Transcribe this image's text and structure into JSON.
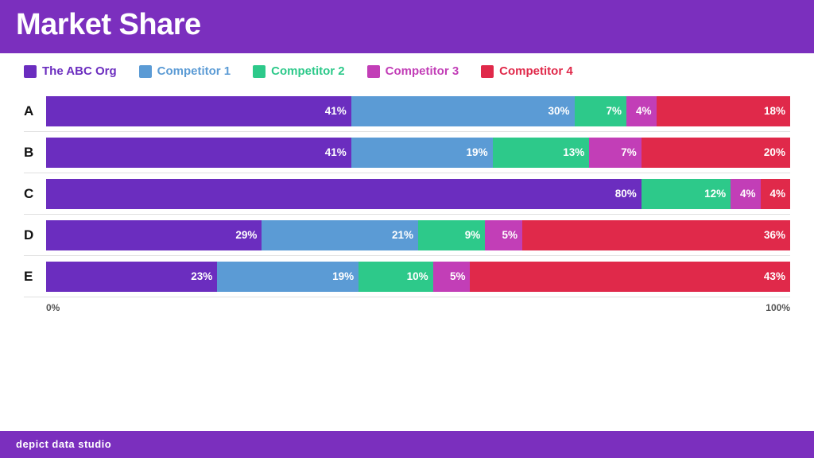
{
  "header": {
    "title": "Market Share"
  },
  "footer": {
    "label": "depict data studio"
  },
  "legend": {
    "items": [
      {
        "id": "abc",
        "label": "The ABC Org",
        "color": "#6B2DBF"
      },
      {
        "id": "c1",
        "label": "Competitor 1",
        "color": "#5B9BD5"
      },
      {
        "id": "c2",
        "label": "Competitor 2",
        "color": "#2DC98A"
      },
      {
        "id": "c3",
        "label": "Competitor 3",
        "color": "#C23EB7"
      },
      {
        "id": "c4",
        "label": "Competitor 4",
        "color": "#E0294A"
      }
    ]
  },
  "rows": [
    {
      "label": "A",
      "segments": [
        {
          "pct": 41,
          "color": "#6B2DBF",
          "text": "41%"
        },
        {
          "pct": 30,
          "color": "#5B9BD5",
          "text": "30%"
        },
        {
          "pct": 7,
          "color": "#2DC98A",
          "text": "7%"
        },
        {
          "pct": 4,
          "color": "#C23EB7",
          "text": "4%"
        },
        {
          "pct": 18,
          "color": "#E0294A",
          "text": "18%"
        }
      ]
    },
    {
      "label": "B",
      "segments": [
        {
          "pct": 41,
          "color": "#6B2DBF",
          "text": "41%"
        },
        {
          "pct": 19,
          "color": "#5B9BD5",
          "text": "19%"
        },
        {
          "pct": 13,
          "color": "#2DC98A",
          "text": "13%"
        },
        {
          "pct": 7,
          "color": "#C23EB7",
          "text": "7%"
        },
        {
          "pct": 20,
          "color": "#E0294A",
          "text": "20%"
        }
      ]
    },
    {
      "label": "C",
      "segments": [
        {
          "pct": 80,
          "color": "#6B2DBF",
          "text": "80%"
        },
        {
          "pct": 0,
          "color": "#5B9BD5",
          "text": ""
        },
        {
          "pct": 12,
          "color": "#2DC98A",
          "text": "12%"
        },
        {
          "pct": 4,
          "color": "#C23EB7",
          "text": "4%"
        },
        {
          "pct": 4,
          "color": "#E0294A",
          "text": "4%"
        }
      ]
    },
    {
      "label": "D",
      "segments": [
        {
          "pct": 29,
          "color": "#6B2DBF",
          "text": "29%"
        },
        {
          "pct": 21,
          "color": "#5B9BD5",
          "text": "21%"
        },
        {
          "pct": 9,
          "color": "#2DC98A",
          "text": "9%"
        },
        {
          "pct": 5,
          "color": "#C23EB7",
          "text": "5%"
        },
        {
          "pct": 36,
          "color": "#E0294A",
          "text": "36%"
        }
      ]
    },
    {
      "label": "E",
      "segments": [
        {
          "pct": 23,
          "color": "#6B2DBF",
          "text": "23%"
        },
        {
          "pct": 19,
          "color": "#5B9BD5",
          "text": "19%"
        },
        {
          "pct": 10,
          "color": "#2DC98A",
          "text": "10%"
        },
        {
          "pct": 5,
          "color": "#C23EB7",
          "text": "5%"
        },
        {
          "pct": 43,
          "color": "#E0294A",
          "text": "43%"
        }
      ]
    }
  ],
  "axis": {
    "start": "0%",
    "end": "100%"
  }
}
